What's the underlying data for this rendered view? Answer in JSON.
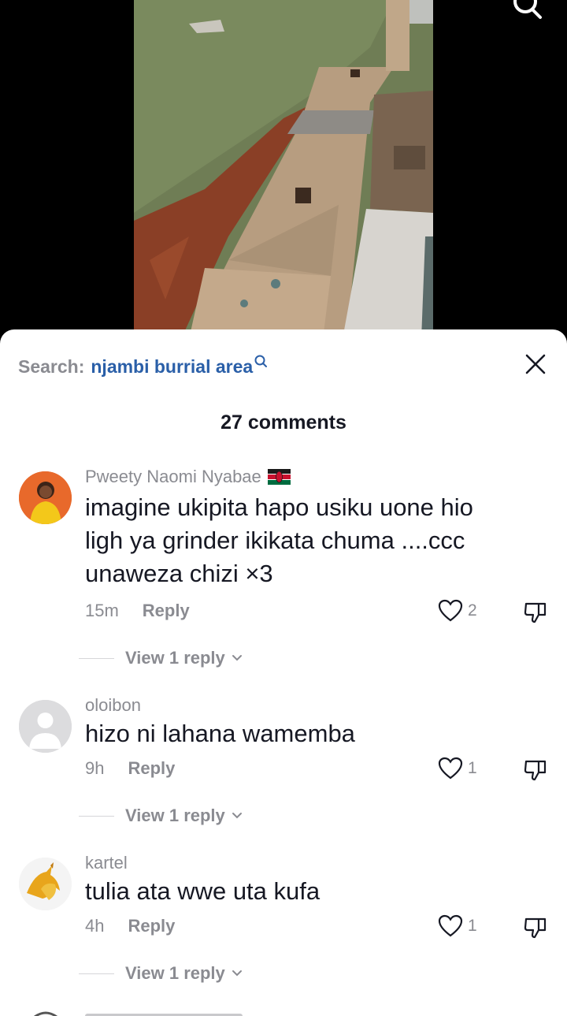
{
  "sheet": {
    "search_prefix": "Search:",
    "search_term": "njambi burrial area",
    "comment_count_label": "27 comments"
  },
  "comments": [
    {
      "username": "Pweety Naomi Nyabae",
      "has_flag": true,
      "text_lines": [
        "imagine ukipita hapo usiku uone hio",
        "ligh ya grinder ikikata chuma ....ccc",
        "unaweza chizi ×3"
      ],
      "time": "15m",
      "reply_label": "Reply",
      "likes": "2",
      "view_replies": "View 1 reply"
    },
    {
      "username": "oloibon",
      "text_lines": [
        "hizo ni lahana wamemba"
      ],
      "time": "9h",
      "reply_label": "Reply",
      "likes": "1",
      "view_replies": "View 1 reply"
    },
    {
      "username": "kartel",
      "text_lines": [
        "tulia ata wwe uta kufa"
      ],
      "time": "4h",
      "reply_label": "Reply",
      "likes": "1",
      "view_replies": "View 1 reply"
    }
  ],
  "colors": {
    "link_blue": "#2a5fa8",
    "muted_gray": "#8a8b91",
    "text_dark": "#161823"
  },
  "icons": {
    "top_search": "search-icon",
    "close": "close-icon",
    "like": "heart-icon",
    "dislike": "thumbs-down-icon"
  }
}
